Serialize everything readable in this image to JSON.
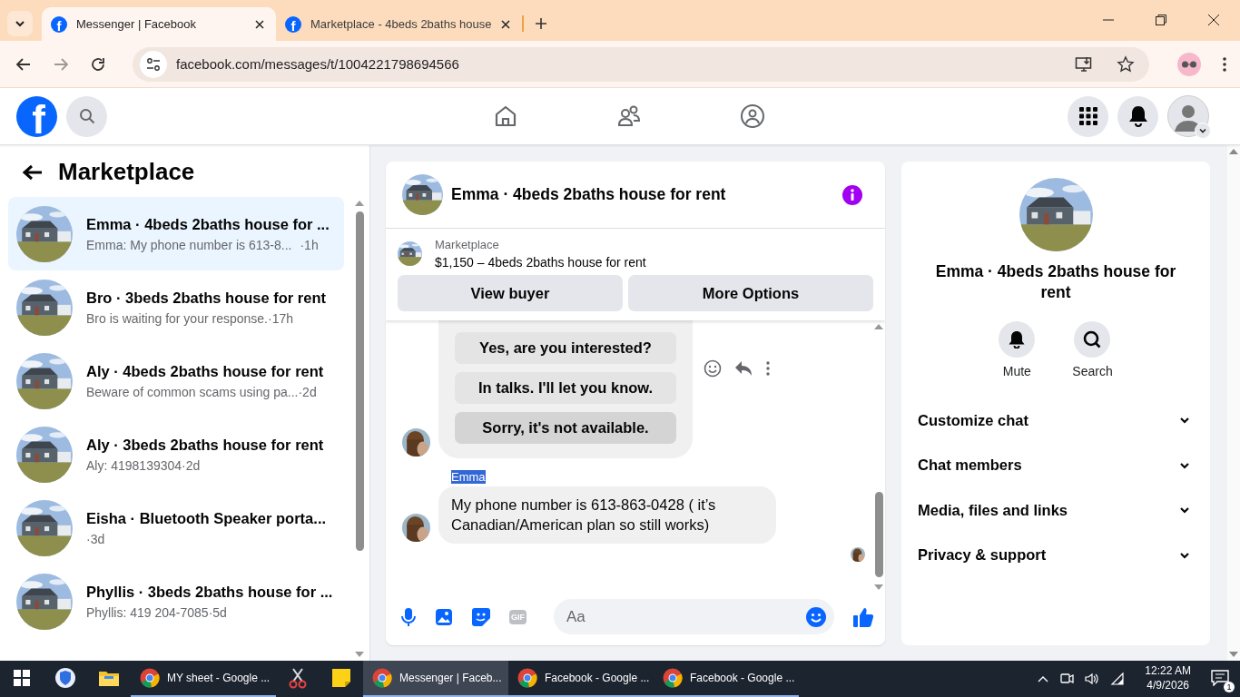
{
  "browser": {
    "tabs": [
      {
        "icon_letter": "f",
        "title": "Messenger | Facebook",
        "selected": true
      },
      {
        "icon_letter": "f",
        "title": "Marketplace - 4beds 2baths house",
        "selected": false
      }
    ],
    "url": "facebook.com/messages/t/1004221798694566"
  },
  "header": {
    "logo": "f"
  },
  "sidebar": {
    "title": "Marketplace",
    "conversations": [
      {
        "title": "Emma · 4beds 2baths house for ...",
        "snippet": "Emma: My phone number is 613-8...",
        "time": "·1h",
        "selected": true
      },
      {
        "title": "Bro · 3beds 2baths house for rent",
        "snippet": "Bro is waiting for your response.",
        "time": "·17h",
        "selected": false
      },
      {
        "title": "Aly · 4beds 2baths house for rent",
        "snippet": "Beware of common scams using pa...",
        "time": "·2d",
        "selected": false
      },
      {
        "title": "Aly · 3beds 2baths house for rent",
        "snippet": "Aly: 4198139304",
        "time": "·2d",
        "selected": false
      },
      {
        "title": "Eisha · Bluetooth Speaker porta...",
        "time": "·3d",
        "selected": false
      },
      {
        "title": "Phyllis · 3beds 2baths house for ...",
        "snippet": "Phyllis: 419 204-7085",
        "time": "·5d",
        "selected": false
      }
    ]
  },
  "chat": {
    "title": "Emma · 4beds 2baths house for rent",
    "listing": {
      "label": "Marketplace",
      "text": "$1,150 – 4beds 2baths house for rent"
    },
    "buttons": [
      "View buyer",
      "More Options"
    ],
    "quick_replies": [
      {
        "text": "Yes, are you interested?",
        "highlighted": false
      },
      {
        "text": "In talks. I'll let you know.",
        "highlighted": false
      },
      {
        "text": "Sorry, it's not available.",
        "highlighted": true
      }
    ],
    "sender": {
      "name": "Emma",
      "text_selected": true
    },
    "message": "My phone number is 613-863-0428 ( it’s Canadian/American plan so still works)",
    "composer": {
      "gif_label": "GIF",
      "placeholder": "Aa"
    }
  },
  "details": {
    "title": "Emma · 4beds 2baths house for rent",
    "actions": [
      {
        "kind": "mute",
        "label": "Mute"
      },
      {
        "kind": "search",
        "label": "Search"
      }
    ],
    "sections": [
      {
        "label": "Customize chat",
        "expanded": false
      },
      {
        "label": "Chat members",
        "expanded": false
      },
      {
        "label": "Media, files and links",
        "expanded": false
      },
      {
        "label": "Privacy & support",
        "expanded": false
      }
    ]
  },
  "taskbar": {
    "apps": [
      {
        "kind": "start",
        "active": false
      },
      {
        "kind": "shield",
        "active": false
      },
      {
        "kind": "folder",
        "active": false
      },
      {
        "kind": "browser",
        "label": "MY sheet - Google ...",
        "active": false
      },
      {
        "kind": "scissors",
        "active": false
      },
      {
        "kind": "note",
        "active": false
      },
      {
        "kind": "browser",
        "label": "Messenger | Faceb...",
        "active": true
      },
      {
        "kind": "browser",
        "label": "Facebook - Google ...",
        "active": false
      },
      {
        "kind": "browser",
        "label": "Facebook - Google ...",
        "active": false
      }
    ],
    "time": "12:22 AM",
    "date": "4/9/2026",
    "notifications": "1"
  }
}
